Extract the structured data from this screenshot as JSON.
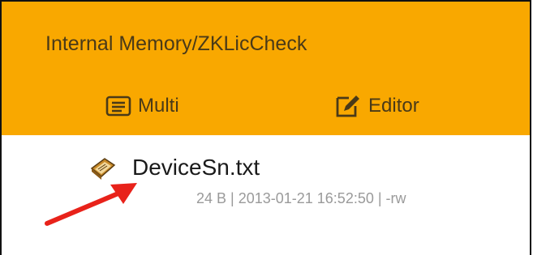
{
  "header": {
    "path": "Internal Memory/ZKLicCheck",
    "actions": [
      {
        "label": "Multi",
        "icon": "multi-select-icon"
      },
      {
        "label": "Editor",
        "icon": "edit-icon"
      }
    ]
  },
  "files": [
    {
      "name": "DeviceSn.txt",
      "meta": "24 B | 2013-01-21 16:52:50 | -rw",
      "icon": "text-file-icon"
    }
  ],
  "colors": {
    "header_bg": "#f9a800",
    "header_text": "#4a3a18",
    "annotation_arrow": "#e8221a"
  }
}
